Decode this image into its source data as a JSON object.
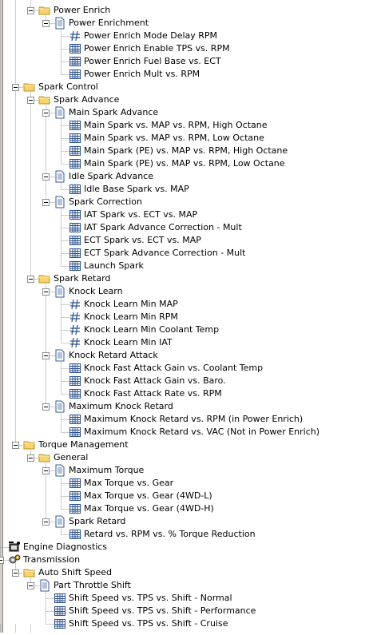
{
  "tree": {
    "items": [
      {
        "label": "Power Enrich",
        "kind": "folder",
        "depth": 2,
        "expanded": true
      },
      {
        "label": "Power Enrichment",
        "kind": "doc",
        "depth": 3,
        "expanded": true
      },
      {
        "label": "Power Enrich Mode Delay RPM",
        "kind": "scalar",
        "depth": 4
      },
      {
        "label": "Power Enrich Enable TPS vs. RPM",
        "kind": "table",
        "depth": 4
      },
      {
        "label": "Power Enrich Fuel Base vs. ECT",
        "kind": "table",
        "depth": 4
      },
      {
        "label": "Power Enrich Mult vs. RPM",
        "kind": "table",
        "depth": 4
      },
      {
        "label": "Spark Control",
        "kind": "folder",
        "depth": 1,
        "expanded": true
      },
      {
        "label": "Spark Advance",
        "kind": "folder",
        "depth": 2,
        "expanded": true
      },
      {
        "label": "Main Spark Advance",
        "kind": "doc",
        "depth": 3,
        "expanded": true
      },
      {
        "label": "Main Spark vs. MAP vs. RPM, High Octane",
        "kind": "table",
        "depth": 4
      },
      {
        "label": "Main Spark vs. MAP vs. RPM, Low Octane",
        "kind": "table",
        "depth": 4
      },
      {
        "label": "Main Spark (PE) vs. MAP vs. RPM, High Octane",
        "kind": "table",
        "depth": 4
      },
      {
        "label": "Main Spark (PE) vs. MAP vs. RPM, Low Octane",
        "kind": "table",
        "depth": 4
      },
      {
        "label": "Idle Spark Advance",
        "kind": "doc",
        "depth": 3,
        "expanded": true
      },
      {
        "label": "Idle Base Spark vs. MAP",
        "kind": "table",
        "depth": 4
      },
      {
        "label": "Spark Correction",
        "kind": "doc",
        "depth": 3,
        "expanded": true
      },
      {
        "label": "IAT Spark vs. ECT vs. MAP",
        "kind": "table",
        "depth": 4
      },
      {
        "label": "IAT Spark Advance Correction - Mult",
        "kind": "table",
        "depth": 4
      },
      {
        "label": "ECT Spark vs. ECT vs. MAP",
        "kind": "table",
        "depth": 4
      },
      {
        "label": "ECT Spark Advance Correction - Mult",
        "kind": "table",
        "depth": 4
      },
      {
        "label": "Launch Spark",
        "kind": "table",
        "depth": 4
      },
      {
        "label": "Spark Retard",
        "kind": "folder",
        "depth": 2,
        "expanded": true
      },
      {
        "label": "Knock Learn",
        "kind": "doc",
        "depth": 3,
        "expanded": true
      },
      {
        "label": "Knock Learn Min MAP",
        "kind": "scalar",
        "depth": 4
      },
      {
        "label": "Knock Learn Min RPM",
        "kind": "scalar",
        "depth": 4
      },
      {
        "label": "Knock Learn Min Coolant Temp",
        "kind": "scalar",
        "depth": 4
      },
      {
        "label": "Knock Learn Min IAT",
        "kind": "scalar",
        "depth": 4
      },
      {
        "label": "Knock Retard Attack",
        "kind": "doc",
        "depth": 3,
        "expanded": true
      },
      {
        "label": "Knock Fast Attack Gain vs. Coolant Temp",
        "kind": "table",
        "depth": 4
      },
      {
        "label": "Knock Fast Attack Gain vs. Baro.",
        "kind": "table",
        "depth": 4
      },
      {
        "label": "Knock Fast Attack Rate vs. RPM",
        "kind": "table",
        "depth": 4
      },
      {
        "label": "Maximum Knock Retard",
        "kind": "doc",
        "depth": 3,
        "expanded": true
      },
      {
        "label": "Maximum Knock Retard vs. RPM  (in Power Enrich)",
        "kind": "table",
        "depth": 4
      },
      {
        "label": "Maximum Knock Retard vs. VAC (Not in Power Enrich)",
        "kind": "table",
        "depth": 4
      },
      {
        "label": "Torque Management",
        "kind": "folder",
        "depth": 1,
        "expanded": true
      },
      {
        "label": "General",
        "kind": "folder",
        "depth": 2,
        "expanded": true
      },
      {
        "label": "Maximum Torque",
        "kind": "doc",
        "depth": 3,
        "expanded": true
      },
      {
        "label": "Max Torque vs. Gear",
        "kind": "table",
        "depth": 4
      },
      {
        "label": "Max Torque vs. Gear (4WD-L)",
        "kind": "table",
        "depth": 4
      },
      {
        "label": "Max Torque vs. Gear (4WD-H)",
        "kind": "table",
        "depth": 4
      },
      {
        "label": "Spark Retard",
        "kind": "doc",
        "depth": 3,
        "expanded": true
      },
      {
        "label": "Retard vs. RPM vs. % Torque Reduction",
        "kind": "table",
        "depth": 4
      },
      {
        "label": "Engine Diagnostics",
        "kind": "diag",
        "depth": 0
      },
      {
        "label": "Transmission",
        "kind": "trans",
        "depth": 0,
        "expanded": true
      },
      {
        "label": "Auto Shift Speed",
        "kind": "folder",
        "depth": 1,
        "expanded": true
      },
      {
        "label": "Part Throttle Shift",
        "kind": "doc",
        "depth": 2,
        "expanded": true
      },
      {
        "label": "Shift Speed vs. TPS vs. Shift - Normal",
        "kind": "table",
        "depth": 3
      },
      {
        "label": "Shift Speed vs. TPS vs. Shift - Performance",
        "kind": "table",
        "depth": 3
      },
      {
        "label": "Shift Speed vs. TPS vs. Shift - Cruise",
        "kind": "table",
        "depth": 3
      }
    ]
  }
}
